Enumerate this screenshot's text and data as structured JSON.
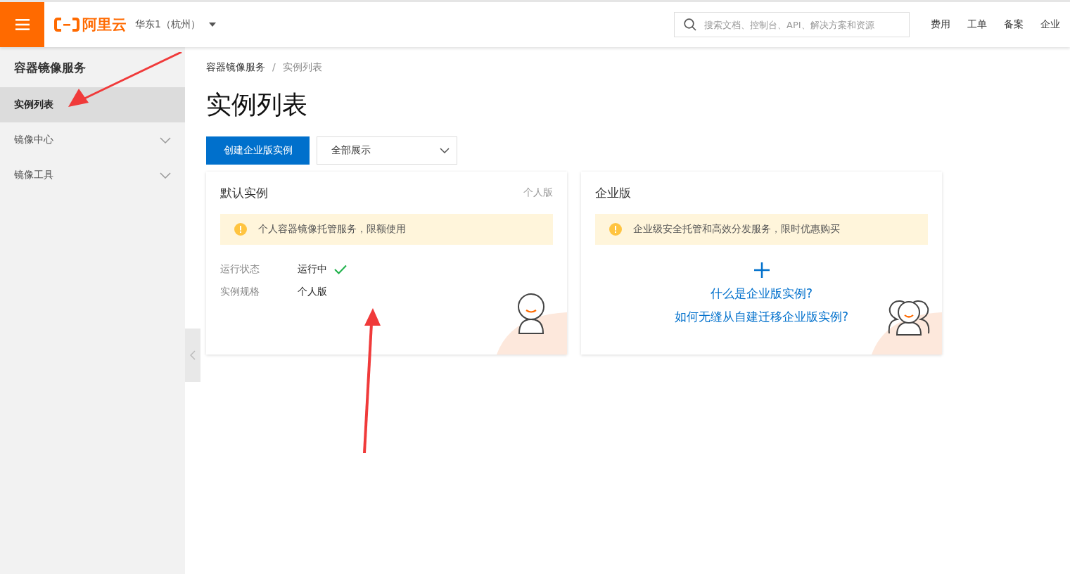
{
  "topbar": {
    "brand": "阿里云",
    "region": "华东1（杭州）",
    "search": {
      "placeholder": "搜索文档、控制台、API、解决方案和资源"
    },
    "links": [
      "费用",
      "工单",
      "备案",
      "企业"
    ]
  },
  "sidebar": {
    "title": "容器镜像服务",
    "items": [
      {
        "label": "实例列表",
        "selected": true,
        "expandable": false
      },
      {
        "label": "镜像中心",
        "selected": false,
        "expandable": true
      },
      {
        "label": "镜像工具",
        "selected": false,
        "expandable": true
      }
    ]
  },
  "breadcrumb": {
    "separator": "/",
    "items": [
      "容器镜像服务",
      "实例列表"
    ]
  },
  "page_title": "实例列表",
  "toolbar": {
    "create_button": "创建企业版实例",
    "filter": "全部展示"
  },
  "cards": [
    {
      "kind": "instance",
      "title": "默认实例",
      "tag": "个人版",
      "notice": "个人容器镜像托管服务，限额使用",
      "fields": [
        {
          "label": "运行状态",
          "value": "运行中",
          "ok": true
        },
        {
          "label": "实例规格",
          "value": "个人版",
          "ok": false
        }
      ]
    },
    {
      "kind": "create",
      "title": "企业版",
      "notice": "企业级安全托管和高效分发服务，限时优惠购买",
      "links": [
        "什么是企业版实例?",
        "如何无缝从自建迁移企业版实例?"
      ]
    }
  ]
}
